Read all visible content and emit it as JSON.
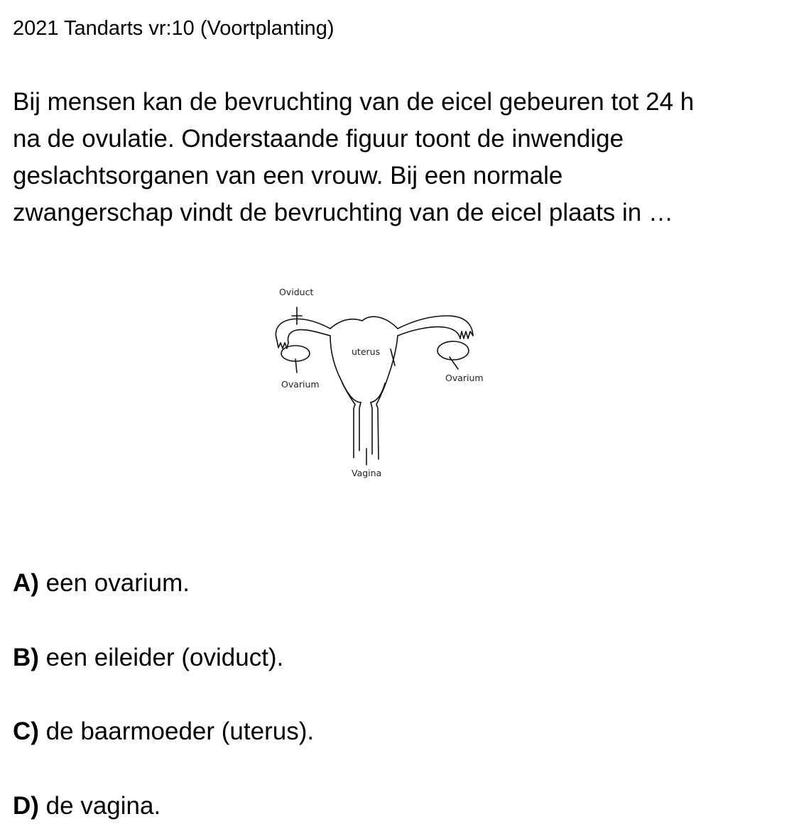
{
  "header": "2021 Tandarts vr:10 (Voortplanting)",
  "question_lines": [
    "Bij mensen kan de bevruchting van de eicel gebeuren tot 24 h",
    "na de ovulatie. Onderstaande figuur toont de inwendige",
    "geslachtsorganen van een vrouw. Bij een normale",
    "zwangerschap vindt de bevruchting van de eicel plaats in …"
  ],
  "figure": {
    "labels": {
      "oviduct": "Oviduct",
      "uterus": "uterus",
      "ovarium_left": "Ovarium",
      "ovarium_right": "Ovarium",
      "vagina": "Vagina"
    }
  },
  "options": [
    {
      "key": "A)",
      "text": "een ovarium."
    },
    {
      "key": "B)",
      "text": "een eileider (oviduct)."
    },
    {
      "key": "C)",
      "text": "de baarmoeder (uterus)."
    },
    {
      "key": "D)",
      "text": "de vagina."
    }
  ]
}
